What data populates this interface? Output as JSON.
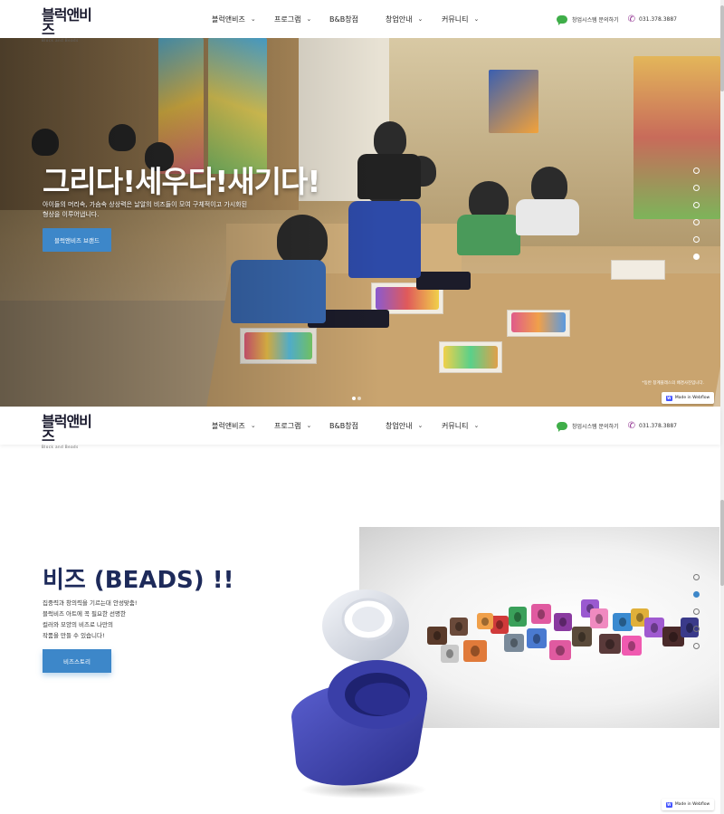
{
  "logo": {
    "text": "블럭앤비즈",
    "sub": "Block and Beads"
  },
  "nav": {
    "items": [
      {
        "label": "블럭앤비즈",
        "dropdown": true
      },
      {
        "label": "프로그램",
        "dropdown": true
      },
      {
        "label": "B&B창점",
        "dropdown": false
      },
      {
        "label": "창업안내",
        "dropdown": true
      },
      {
        "label": "커뮤니티",
        "dropdown": true
      }
    ],
    "consult": "창업시스템 문의하기",
    "phone": "031.378.3887"
  },
  "hero": {
    "title": "그리다!세우다!새기다!",
    "description": "아이들의 머리속, 가슴속 상상력은 날알의 비즈들이 모여 구체적이고 가시화된 형상을 이루어냅니다.",
    "button": "블럭앤비즈 브랜드",
    "caption": "*동반 창계플래스의 배경사진입니다.",
    "vertical_dots": 6,
    "vertical_active": 5
  },
  "beads": {
    "title": "비즈 (BEADS) !!",
    "description_lines": [
      "집중력과 창의력을 기르는대 안성맞춤!",
      "블럭비즈 아트에 꼭 필요한 선명한",
      "컬러와 모양의 비즈로 나만의",
      "작품을 만들 수 있습니다!"
    ],
    "button": "비즈스토리",
    "dots": 5,
    "active": 1
  },
  "badge": {
    "label": "Made in Webflow"
  },
  "colors": {
    "accent": "#3d87c9",
    "title_navy": "#1d2a5a",
    "tube_blue": "#3a3fa8"
  }
}
